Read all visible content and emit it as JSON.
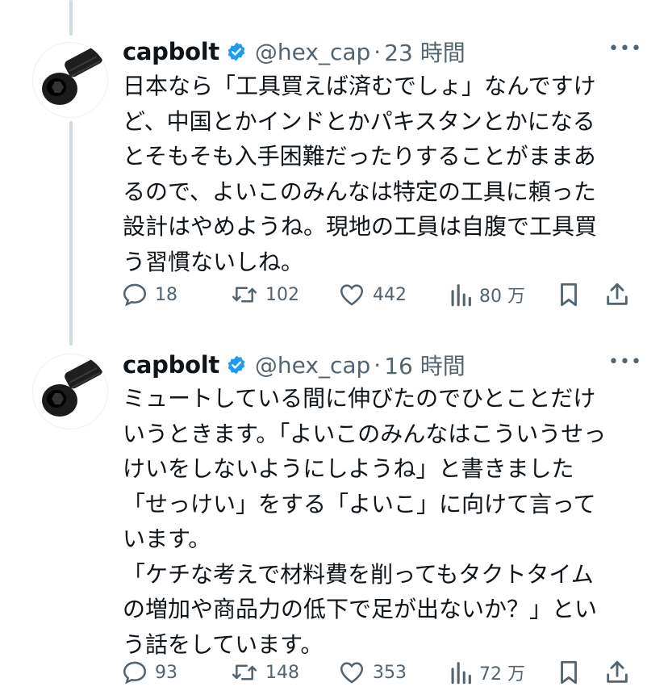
{
  "tweets": [
    {
      "name": "capbolt",
      "handle": "@hex_cap",
      "separator": "·",
      "time": "23 時間",
      "text": "日本なら「工具買えば済むでしょ」なんですけど、中国とかインドとかパキスタンとかになるとそもそも入手困難だったりすることがままあるので、よいこのみんなは特定の工具に頼った設計はやめようね。現地の工員は自腹で工具買う習慣ないしね。",
      "replies": "18",
      "retweets": "102",
      "likes": "442",
      "views": "80 万"
    },
    {
      "name": "capbolt",
      "handle": "@hex_cap",
      "separator": "·",
      "time": "16 時間",
      "text": "ミュートしている間に伸びたのでひとことだけいうときます。「よいこのみんなはこういうせっけいをしないようにしようね」と書きました「せっけい」をする「よいこ」に向けて言っています。\n「ケチな考えで材料費を削ってもタクトタイムの増加や商品力の低下で足が出ないか？」という話をしています。",
      "replies": "93",
      "retweets": "148",
      "likes": "353",
      "views": "72 万"
    }
  ],
  "icons": {
    "verified": "verified-badge-icon",
    "more": "more-options-icon",
    "reply": "reply-icon",
    "retweet": "retweet-icon",
    "like": "heart-icon",
    "views": "views-chart-icon",
    "bookmark": "bookmark-icon",
    "share": "share-icon"
  },
  "colors": {
    "text": "#0f1419",
    "secondary": "#536471",
    "verified": "#1d9bf0",
    "thread_line": "#cfd9de"
  }
}
